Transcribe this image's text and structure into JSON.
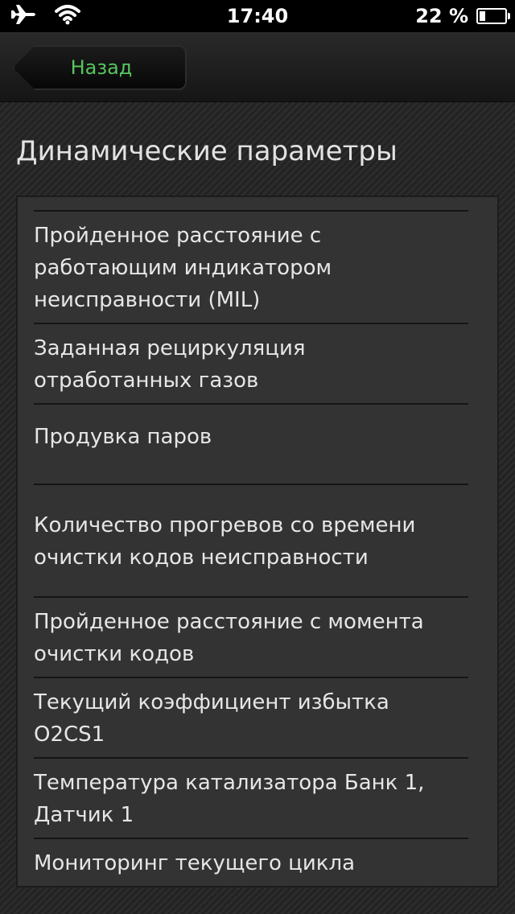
{
  "status_bar": {
    "time": "17:40",
    "battery_text": "22 %",
    "battery_level": 0.22,
    "icons": [
      "airplane-icon",
      "wifi-icon",
      "battery-icon"
    ]
  },
  "nav": {
    "back_label": "Назад",
    "back_color": "#56c65e"
  },
  "page": {
    "title": "Динамические параметры"
  },
  "list": {
    "items": [
      {
        "label": "Пройденное расстояние с\nработающим индикатором\nнеисправности (MIL)"
      },
      {
        "label": "Заданная рециркуляция\nотработанных газов"
      },
      {
        "label": "Продувка паров"
      },
      {
        "label": "Количество прогревов со времени\nочистки кодов неисправности"
      },
      {
        "label": "Пройденное расстояние с момента\nочистки кодов"
      },
      {
        "label": "Текущий коэффициент избытка\nO2CS1"
      },
      {
        "label": "Температура катализатора Банк 1,\nДатчик 1"
      },
      {
        "label": "Мониторинг текущего цикла"
      }
    ]
  }
}
